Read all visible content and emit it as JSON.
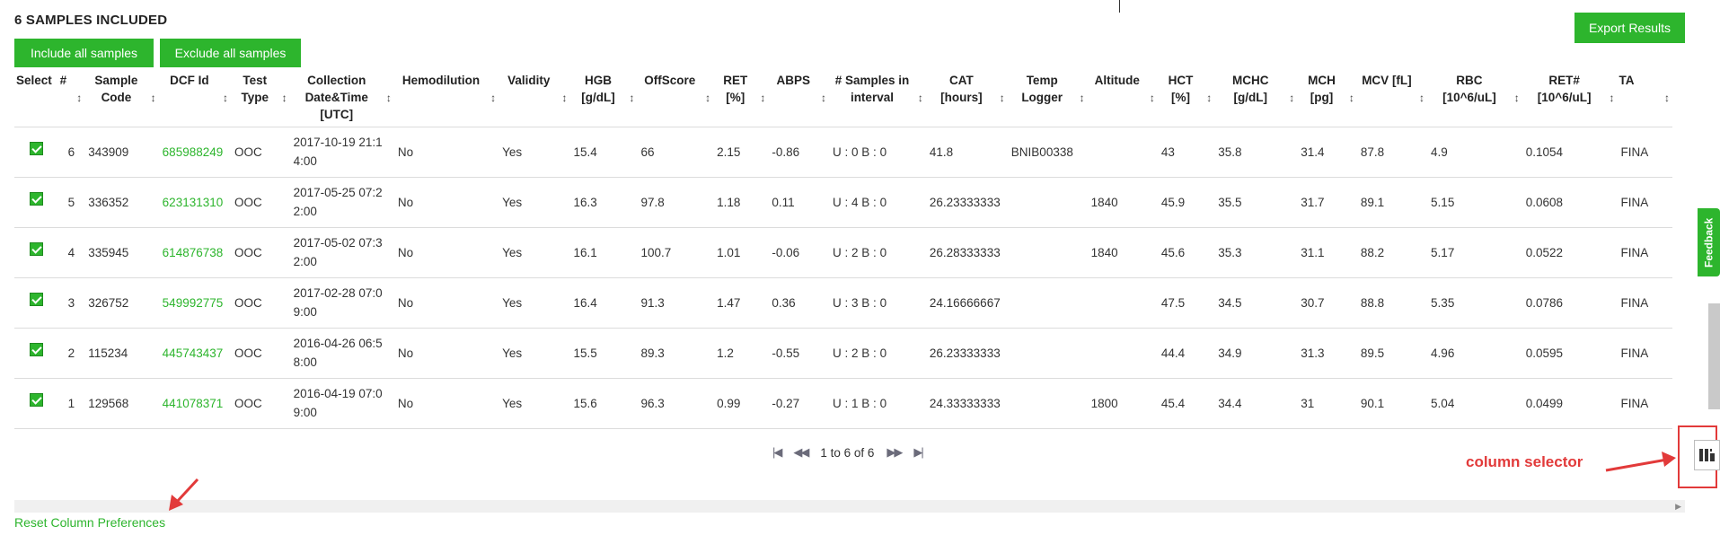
{
  "header": {
    "title": "6 SAMPLES INCLUDED",
    "include_all": "Include all samples",
    "exclude_all": "Exclude all samples",
    "export": "Export Results"
  },
  "table": {
    "columns": [
      {
        "key": "select",
        "label": "Select",
        "sortable": false
      },
      {
        "key": "num",
        "label": "#",
        "sortable": true
      },
      {
        "key": "sample_code",
        "label": "Sample Code",
        "sortable": true
      },
      {
        "key": "dcf_id",
        "label": "DCF Id",
        "sortable": true
      },
      {
        "key": "test_type",
        "label": "Test Type",
        "sortable": true
      },
      {
        "key": "collection",
        "label": "Collection Date&Time [UTC]",
        "sortable": true
      },
      {
        "key": "hemodilution",
        "label": "Hemodilution",
        "sortable": true
      },
      {
        "key": "validity",
        "label": "Validity",
        "sortable": true
      },
      {
        "key": "hgb",
        "label": "HGB [g/dL]",
        "sortable": true
      },
      {
        "key": "offscore",
        "label": "OffScore",
        "sortable": true
      },
      {
        "key": "ret",
        "label": "RET [%]",
        "sortable": true
      },
      {
        "key": "abps",
        "label": "ABPS",
        "sortable": true
      },
      {
        "key": "samples_interval",
        "label": "# Samples in interval",
        "sortable": true
      },
      {
        "key": "cat",
        "label": "CAT [hours]",
        "sortable": true
      },
      {
        "key": "temp_logger",
        "label": "Temp Logger",
        "sortable": true
      },
      {
        "key": "altitude",
        "label": "Altitude",
        "sortable": true
      },
      {
        "key": "hct",
        "label": "HCT [%]",
        "sortable": true
      },
      {
        "key": "mchc",
        "label": "MCHC [g/dL]",
        "sortable": true
      },
      {
        "key": "mch",
        "label": "MCH [pg]",
        "sortable": true
      },
      {
        "key": "mcv",
        "label": "MCV [fL]",
        "sortable": true
      },
      {
        "key": "rbc",
        "label": "RBC [10^6/uL]",
        "sortable": true
      },
      {
        "key": "retabs",
        "label": "RET# [10^6/uL]",
        "sortable": true
      },
      {
        "key": "ta",
        "label": "TA",
        "sortable": true
      }
    ],
    "rows": [
      {
        "selected": true,
        "num": "6",
        "sample_code": "343909",
        "dcf_id": "685988249",
        "test_type": "OOC",
        "collection": "2017-10-19 21:14:00",
        "hemodilution": "No",
        "validity": "Yes",
        "hgb": "15.4",
        "offscore": "66",
        "ret": "2.15",
        "abps": "-0.86",
        "samples_interval": "U : 0 B : 0",
        "cat": "41.8",
        "temp_logger": "BNIB00338",
        "altitude": "",
        "hct": "43",
        "mchc": "35.8",
        "mch": "31.4",
        "mcv": "87.8",
        "rbc": "4.9",
        "retabs": "0.1054",
        "ta": "FINA"
      },
      {
        "selected": true,
        "num": "5",
        "sample_code": "336352",
        "dcf_id": "623131310",
        "test_type": "OOC",
        "collection": "2017-05-25 07:22:00",
        "hemodilution": "No",
        "validity": "Yes",
        "hgb": "16.3",
        "offscore": "97.8",
        "ret": "1.18",
        "abps": "0.11",
        "samples_interval": "U : 4 B : 0",
        "cat": "26.23333333",
        "temp_logger": "",
        "altitude": "1840",
        "hct": "45.9",
        "mchc": "35.5",
        "mch": "31.7",
        "mcv": "89.1",
        "rbc": "5.15",
        "retabs": "0.0608",
        "ta": "FINA"
      },
      {
        "selected": true,
        "num": "4",
        "sample_code": "335945",
        "dcf_id": "614876738",
        "test_type": "OOC",
        "collection": "2017-05-02 07:32:00",
        "hemodilution": "No",
        "validity": "Yes",
        "hgb": "16.1",
        "offscore": "100.7",
        "ret": "1.01",
        "abps": "-0.06",
        "samples_interval": "U : 2 B : 0",
        "cat": "26.28333333",
        "temp_logger": "",
        "altitude": "1840",
        "hct": "45.6",
        "mchc": "35.3",
        "mch": "31.1",
        "mcv": "88.2",
        "rbc": "5.17",
        "retabs": "0.0522",
        "ta": "FINA"
      },
      {
        "selected": true,
        "num": "3",
        "sample_code": "326752",
        "dcf_id": "549992775",
        "test_type": "OOC",
        "collection": "2017-02-28 07:09:00",
        "hemodilution": "No",
        "validity": "Yes",
        "hgb": "16.4",
        "offscore": "91.3",
        "ret": "1.47",
        "abps": "0.36",
        "samples_interval": "U : 3 B : 0",
        "cat": "24.16666667",
        "temp_logger": "",
        "altitude": "",
        "hct": "47.5",
        "mchc": "34.5",
        "mch": "30.7",
        "mcv": "88.8",
        "rbc": "5.35",
        "retabs": "0.0786",
        "ta": "FINA"
      },
      {
        "selected": true,
        "num": "2",
        "sample_code": "115234",
        "dcf_id": "445743437",
        "test_type": "OOC",
        "collection": "2016-04-26 06:58:00",
        "hemodilution": "No",
        "validity": "Yes",
        "hgb": "15.5",
        "offscore": "89.3",
        "ret": "1.2",
        "abps": "-0.55",
        "samples_interval": "U : 2 B : 0",
        "cat": "26.23333333",
        "temp_logger": "",
        "altitude": "",
        "hct": "44.4",
        "mchc": "34.9",
        "mch": "31.3",
        "mcv": "89.5",
        "rbc": "4.96",
        "retabs": "0.0595",
        "ta": "FINA"
      },
      {
        "selected": true,
        "num": "1",
        "sample_code": "129568",
        "dcf_id": "441078371",
        "test_type": "OOC",
        "collection": "2016-04-19 07:09:00",
        "hemodilution": "No",
        "validity": "Yes",
        "hgb": "15.6",
        "offscore": "96.3",
        "ret": "0.99",
        "abps": "-0.27",
        "samples_interval": "U : 1 B : 0",
        "cat": "24.33333333",
        "temp_logger": "",
        "altitude": "1800",
        "hct": "45.4",
        "mchc": "34.4",
        "mch": "31",
        "mcv": "90.1",
        "rbc": "5.04",
        "retabs": "0.0499",
        "ta": "FINA"
      }
    ]
  },
  "pager": {
    "summary": "1 to 6 of 6"
  },
  "footer": {
    "reset_link": "Reset Column Preferences"
  },
  "side": {
    "feedback": "Feedback"
  },
  "annotation": {
    "column_selector": "column selector"
  },
  "icons": {
    "first": "first-page-icon",
    "prev": "prev-page-icon",
    "next": "next-page-icon",
    "last": "last-page-icon",
    "columns": "columns-icon",
    "sort": "sort-arrows-icon"
  },
  "colors": {
    "accent": "#2db52d",
    "annotation": "#e23a3a"
  }
}
